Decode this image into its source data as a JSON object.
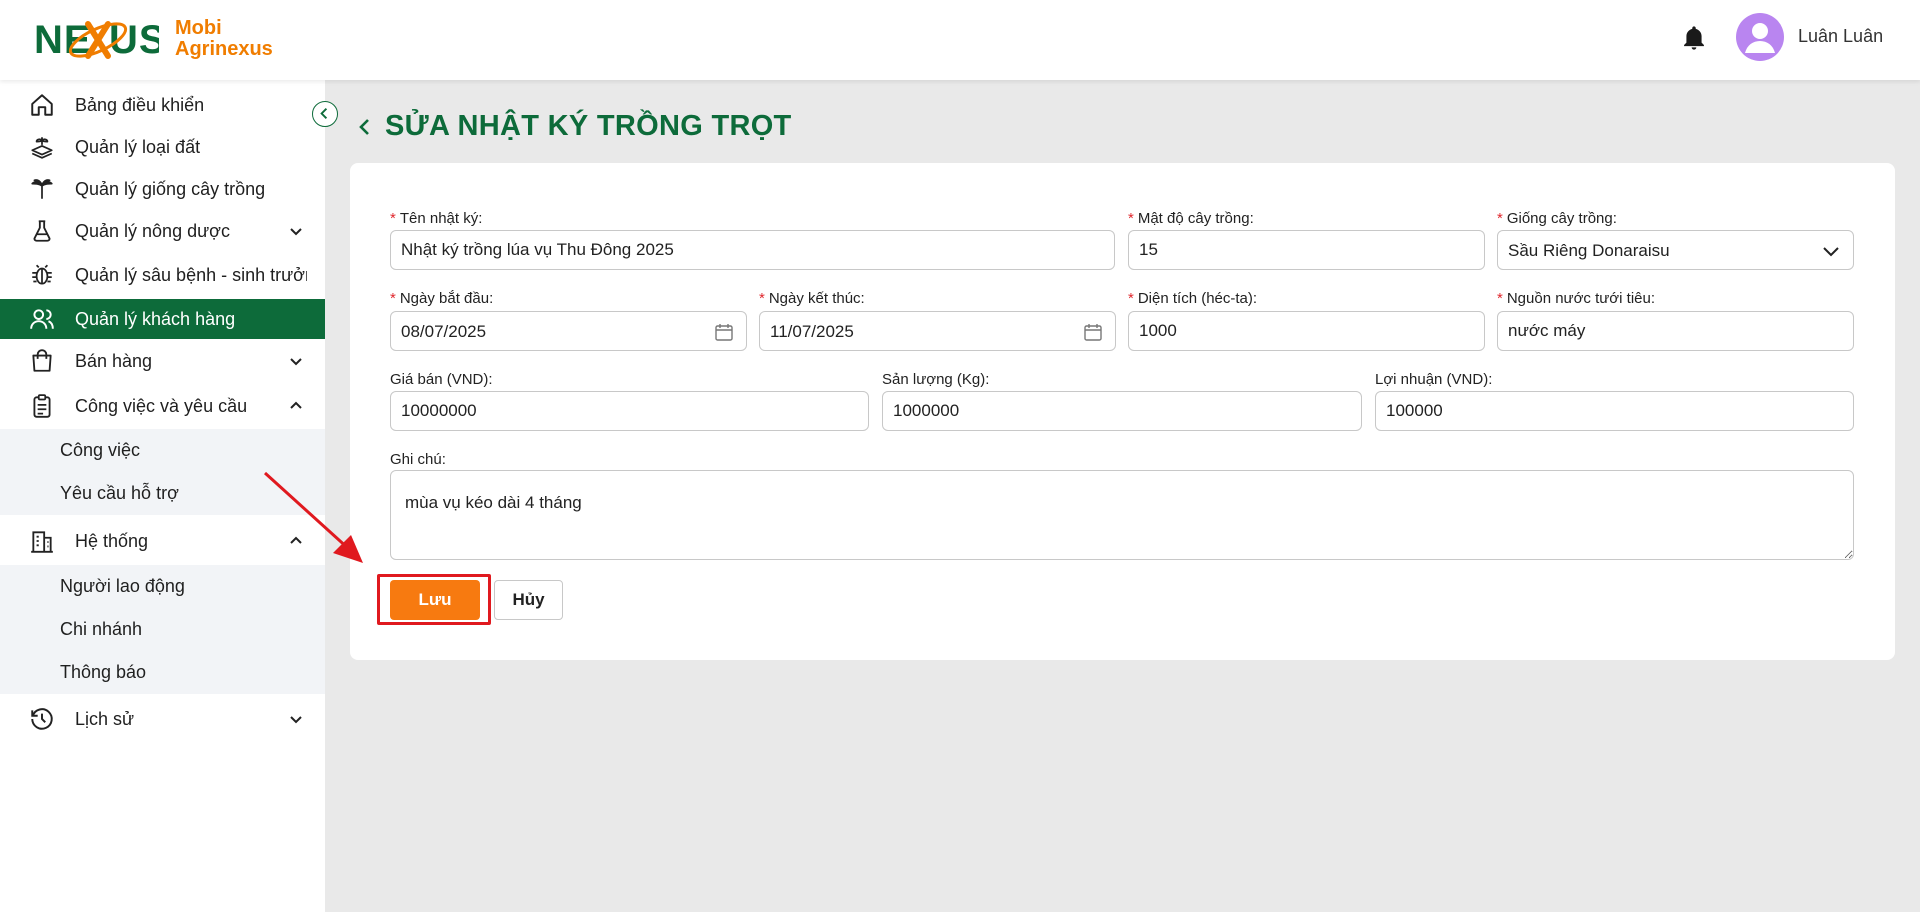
{
  "app": {
    "logo_text_line1": "Mobi",
    "logo_text_line2": "Agrinexus",
    "logo_wordmark": "NEXUS"
  },
  "header": {
    "user_name": "Luân Luân",
    "icons": [
      "bell-icon",
      "user-avatar-icon"
    ]
  },
  "sidebar": {
    "items": [
      {
        "label": "Bảng điều khiển",
        "icon": "home-icon"
      },
      {
        "label": "Quản lý loại đất",
        "icon": "soil-icon"
      },
      {
        "label": "Quản lý giống cây trồng",
        "icon": "palm-tree-icon"
      },
      {
        "label": "Quản lý nông dược",
        "icon": "flask-icon",
        "expandable": true
      },
      {
        "label": "Quản lý sâu bệnh - sinh trưởng",
        "icon": "bug-icon"
      },
      {
        "label": "Quản lý khách hàng",
        "icon": "users-icon",
        "active": true
      },
      {
        "label": "Bán hàng",
        "icon": "shopping-bag-icon",
        "expandable": true
      },
      {
        "label": "Công việc và yêu cầu",
        "icon": "clipboard-icon",
        "expanded": true
      },
      {
        "label": "Hệ thống",
        "icon": "building-icon",
        "expanded": true
      },
      {
        "label": "Lịch sử",
        "icon": "clock-icon",
        "expandable": true
      }
    ],
    "tasks_sub": [
      "Công việc",
      "Yêu cầu hỗ trợ"
    ],
    "system_sub": [
      "Người lao động",
      "Chi nhánh",
      "Thông báo"
    ]
  },
  "page": {
    "title": "SỬA NHẬT KÝ TRỒNG TRỌT"
  },
  "form": {
    "name_label": "Tên nhật ký:",
    "name_value": "Nhật ký trồng lúa vụ Thu Đông 2025",
    "density_label": "Mật độ cây trồng:",
    "density_value": "15",
    "variety_label": "Giống cây trồng:",
    "variety_value": "Sầu Riêng Donaraisu",
    "start_label": "Ngày bắt đầu:",
    "start_value": "08/07/2025",
    "end_label": "Ngày kết thúc:",
    "end_value": "11/07/2025",
    "area_label": "Diện tích (héc-ta):",
    "area_value": "1000",
    "water_label": "Nguồn nước tưới tiêu:",
    "water_value": "nước máy",
    "price_label": "Giá bán (VND):",
    "price_value": "10000000",
    "yield_label": "Sản lượng (Kg):",
    "yield_value": "1000000",
    "profit_label": "Lợi nhuận (VND):",
    "profit_value": "100000",
    "note_label": "Ghi chú:",
    "note_value": "mùa vụ kéo dài 4 tháng",
    "required_mark": "*",
    "save_label": "Lưu",
    "cancel_label": "Hủy"
  },
  "colors": {
    "primary_green": "#0d6b3a",
    "accent_orange": "#f77a10",
    "highlight_red": "#e0191f"
  }
}
